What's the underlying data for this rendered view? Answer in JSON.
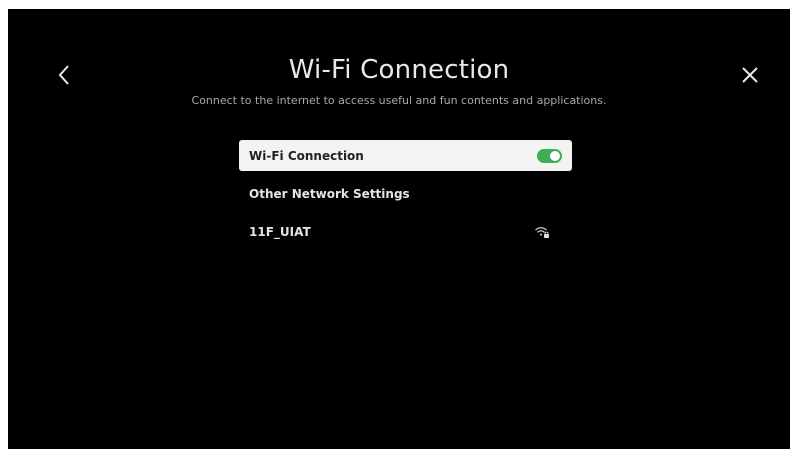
{
  "header": {
    "title": "Wi-Fi Connection",
    "subtitle": "Connect to the internet to access useful and fun contents and applications."
  },
  "menu": {
    "items": [
      {
        "label": "Wi-Fi Connection",
        "toggle_on": true
      },
      {
        "label": "Other Network Settings"
      },
      {
        "label": "11F_UIAT",
        "icon": "wifi-locked-icon"
      }
    ]
  },
  "icons": {
    "back": "chevron-left-icon",
    "close": "close-icon"
  },
  "colors": {
    "background": "#000000",
    "focus": "#f3f3f3",
    "toggle_on": "#3fae57"
  }
}
